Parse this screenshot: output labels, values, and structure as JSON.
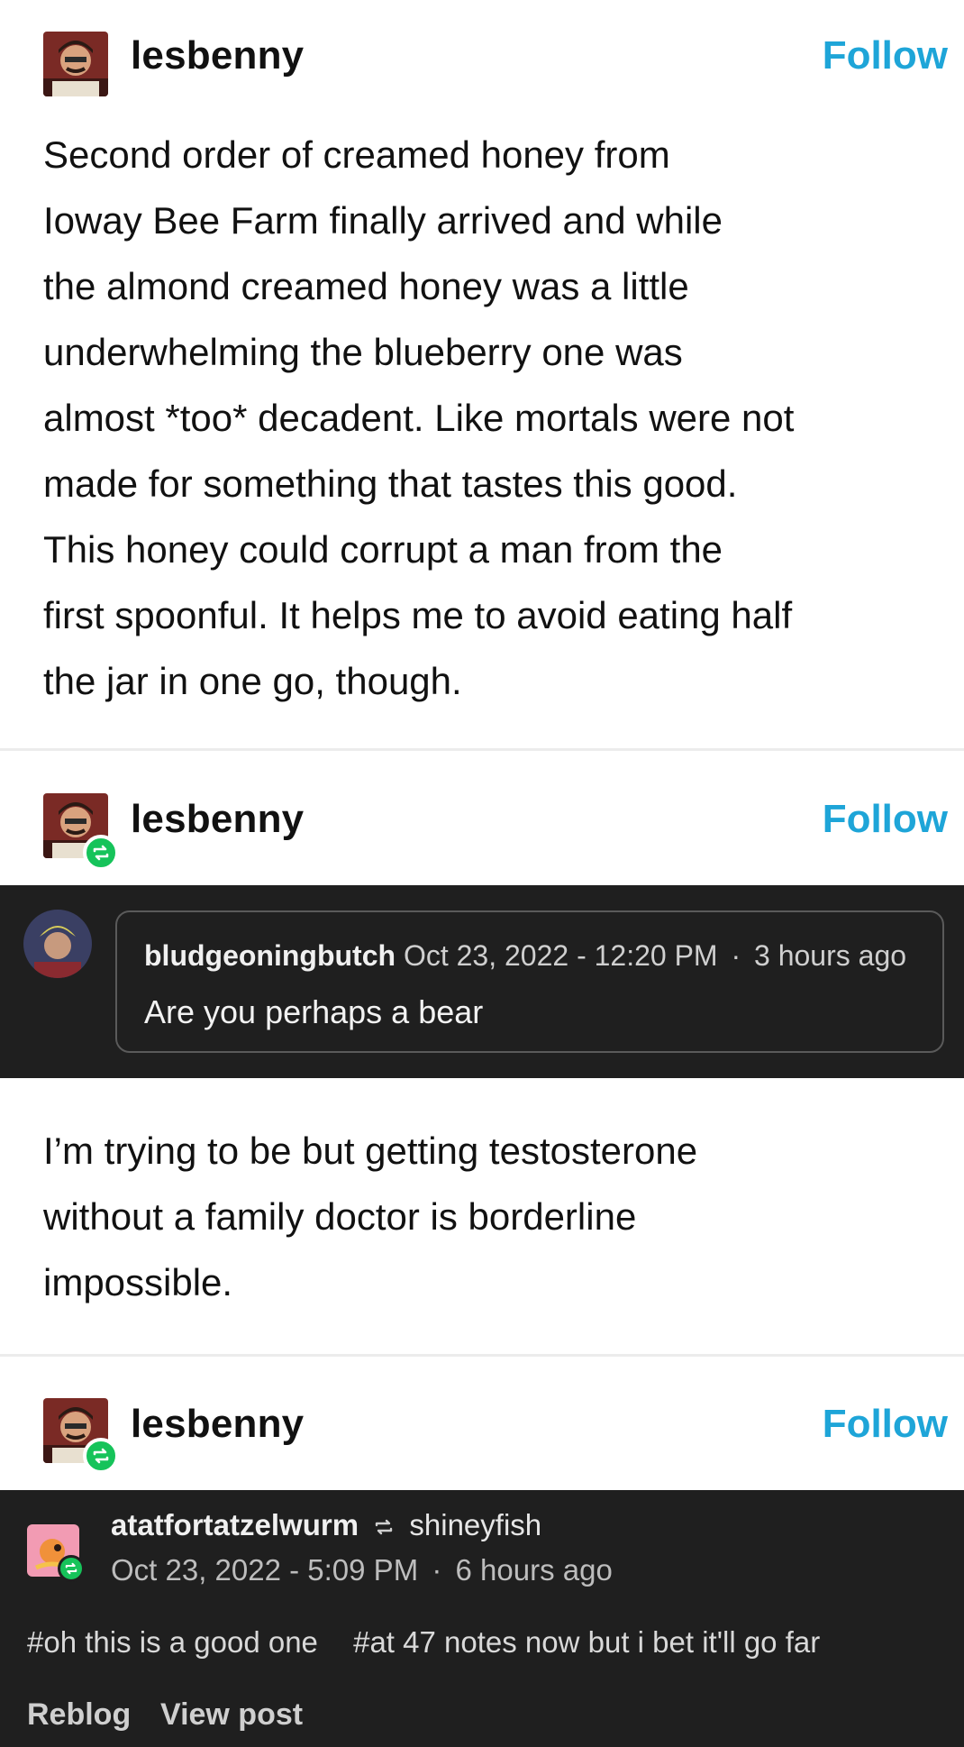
{
  "post1": {
    "username": "lesbenny",
    "follow_label": "Follow",
    "body": "Second order of creamed honey from Ioway Bee Farm finally arrived and while the almond creamed honey was a little underwhelming the blueberry one was almost *too* decadent. Like mortals were not made for something that tastes this good. This honey could corrupt a man from the first spoonful. It helps me to avoid eating half the jar in one go, though.",
    "lines": [
      "Second order of creamed honey from",
      "Ioway Bee Farm finally arrived and while",
      "the almond creamed honey was a little",
      "underwhelming the blueberry one was",
      "almost *too* decadent. Like mortals were not",
      "made for something that tastes this good.",
      "This honey could corrupt a man from the",
      "first spoonful. It helps me to avoid eating half",
      "the jar in one go, though."
    ]
  },
  "post2": {
    "username": "lesbenny",
    "follow_label": "Follow",
    "ask": {
      "asker": "bludgeoningbutch",
      "date": "Oct 23, 2022 - 12:20 PM",
      "separator": "·",
      "relative": "3 hours ago",
      "text": "Are you perhaps a bear"
    },
    "answer_lines": [
      "I’m trying to be but getting testosterone",
      "without a family doctor is borderline",
      "impossible."
    ]
  },
  "post3": {
    "username": "lesbenny",
    "follow_label": "Follow",
    "note": {
      "user": "atatfortatzelwurm",
      "reblogged_from": "shineyfish",
      "date": "Oct 23, 2022 - 5:09 PM",
      "separator": "·",
      "relative": "6 hours ago",
      "tags": [
        "#oh this is a good one",
        "#at 47 notes now but i bet it'll go far"
      ],
      "reblog_label": "Reblog",
      "view_post_label": "View post"
    }
  },
  "colors": {
    "follow": "#1ea5d8",
    "reblog_green": "#16c35a",
    "dark_band": "#1f1f1f"
  }
}
